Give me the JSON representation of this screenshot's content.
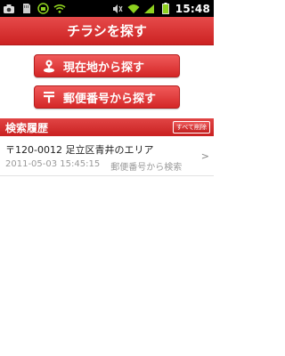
{
  "status_bar": {
    "time": "15:48",
    "icons": [
      "camera-icon",
      "sd-card-icon",
      "android-debug-icon",
      "wifi-icon",
      "mute-icon",
      "wifi-signal-icon",
      "signal-icon",
      "battery-icon"
    ]
  },
  "header": {
    "title": "チラシを探す"
  },
  "actions": {
    "current_location_label": "現在地から探す",
    "postal_code_label": "郵便番号から探す"
  },
  "history": {
    "title": "検索履歴",
    "delete_all_label": "すべて削除",
    "items": [
      {
        "address": "〒120-0012 足立区青井のエリア",
        "datetime": "2011-05-03 15:45:15",
        "method": "郵便番号から検索"
      }
    ]
  },
  "colors": {
    "brand_red": "#d42727",
    "status_bar": "#000000"
  }
}
